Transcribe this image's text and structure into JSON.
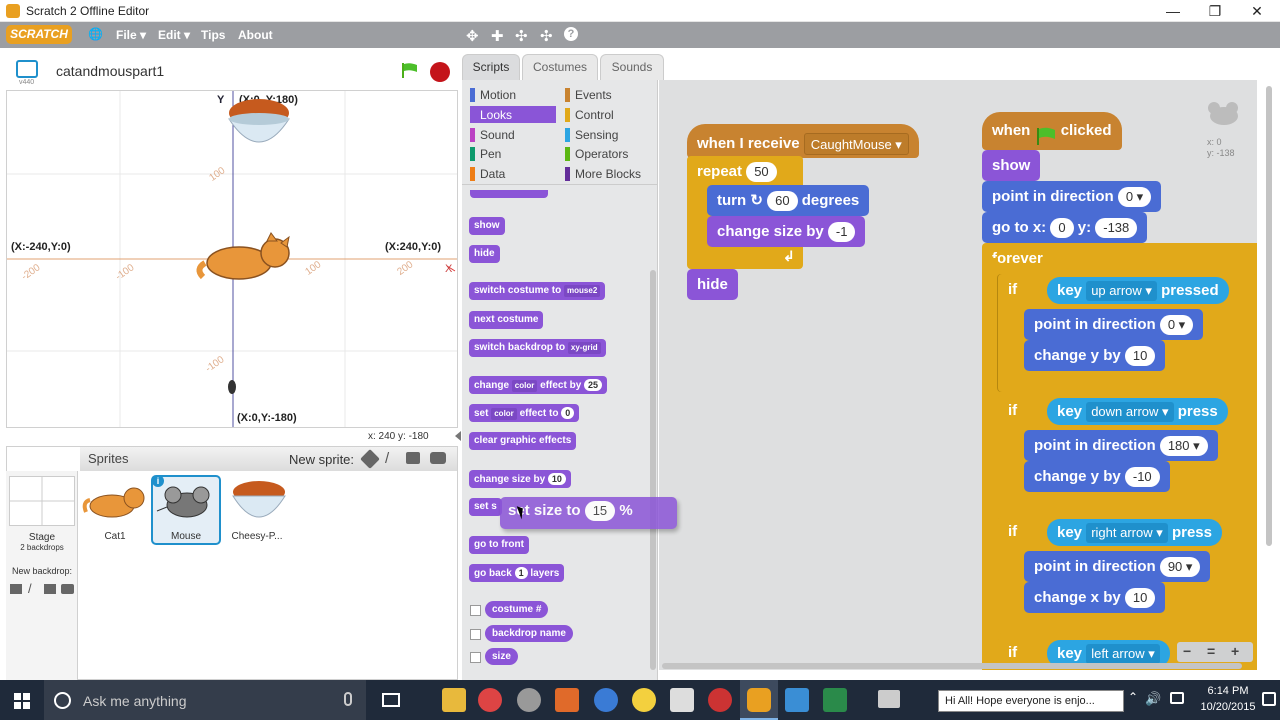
{
  "window": {
    "title": "Scratch 2 Offline Editor",
    "minimize": "—",
    "restore": "❐",
    "close": "✕"
  },
  "menubar": {
    "logo": "SCRATCH",
    "globe": "🌐",
    "file": "File ▾",
    "edit": "Edit ▾",
    "tips": "Tips",
    "about": "About",
    "tools": [
      "✥",
      "✚",
      "✣",
      "✣",
      "?"
    ]
  },
  "stage": {
    "project_name": "catandmouspart1",
    "version": "v440",
    "axis_y_label": "Y",
    "axis_x_label": "X",
    "top_label": "(X:0, Y:180)",
    "left_label": "(X:-240,Y:0)",
    "right_label": "(X:240,Y:0)",
    "bottom_label": "(X:0,Y:-180)",
    "ticks": [
      "-200",
      "-100",
      "100",
      "200",
      "100",
      "-100"
    ],
    "mouse_readout": "x: 240   y: -180"
  },
  "sprites_panel": {
    "title": "Sprites",
    "new_sprite": "New sprite:",
    "stage_label": "Stage",
    "backdrops": "2 backdrops",
    "new_backdrop": "New backdrop:",
    "sprites": [
      {
        "name": "Cat1"
      },
      {
        "name": "Mouse"
      },
      {
        "name": "Cheesy-P..."
      }
    ],
    "info_badge": "i"
  },
  "tabs": [
    "Scripts",
    "Costumes",
    "Sounds"
  ],
  "categories": [
    {
      "name": "Motion",
      "color": "#4a6cd4"
    },
    {
      "name": "Events",
      "color": "#c88330"
    },
    {
      "name": "Looks",
      "color": "#8a55d7"
    },
    {
      "name": "Control",
      "color": "#e1a91a"
    },
    {
      "name": "Sound",
      "color": "#bb42c3"
    },
    {
      "name": "Sensing",
      "color": "#2ca5e2"
    },
    {
      "name": "Pen",
      "color": "#0e9a6c"
    },
    {
      "name": "Operators",
      "color": "#5cb712"
    },
    {
      "name": "Data",
      "color": "#ee7d16"
    },
    {
      "name": "More Blocks",
      "color": "#632d99"
    }
  ],
  "palette": {
    "show": "show",
    "hide": "hide",
    "switch_costume": "switch costume to",
    "switch_costume_val": "mouse2",
    "next_costume": "next costume",
    "switch_backdrop": "switch backdrop to",
    "switch_backdrop_val": "xy-grid",
    "change_effect": "change",
    "change_effect_dd": "color",
    "change_effect_mid": "effect by",
    "change_effect_val": "25",
    "set_effect": "set",
    "set_effect_dd": "color",
    "set_effect_mid": "effect to",
    "set_effect_val": "0",
    "clear_effects": "clear graphic effects",
    "change_size": "change size by",
    "change_size_val": "10",
    "set_partial": "set s",
    "go_front": "go to front",
    "go_back": "go back",
    "go_back_val": "1",
    "go_back_end": "layers",
    "rep_costume": "costume #",
    "rep_backdrop": "backdrop name",
    "rep_size": "size"
  },
  "dragging": {
    "pre": "set size to",
    "val": "15",
    "post": "%"
  },
  "scripts": {
    "when_receive": "when I receive",
    "message": "CaughtMouse",
    "repeat": "repeat",
    "repeat_val": "50",
    "turn": "turn",
    "turn_val": "60",
    "degrees": "degrees",
    "change_size": "change size by",
    "change_size_val": "-1",
    "hide": "hide",
    "when": "when",
    "clicked": "clicked",
    "show": "show",
    "point_dir": "point in direction",
    "point_dir_val": "0",
    "goto": "go to x:",
    "goto_x": "0",
    "goto_y_lbl": "y:",
    "goto_y": "-138",
    "forever": "forever",
    "if": "if",
    "key": "key",
    "up_arrow": "up arrow",
    "down_arrow": "down arrow",
    "right_arrow": "right arrow",
    "left_arrow": "left arrow",
    "pressed": "pressed",
    "press": "press",
    "pd0": "0",
    "change_y": "change y by",
    "change_y_val": "10",
    "pd180": "180",
    "change_y_val2": "-10",
    "pd90": "90",
    "change_x": "change x by",
    "change_x_val": "10",
    "readout_x": "x: 0",
    "readout_y": "y: -138",
    "zoom_out": "−",
    "zoom_reset": "=",
    "zoom_in": "+"
  },
  "taskbar": {
    "search": "Ask me anything",
    "notification": "Hi All! Hope everyone is enjo...",
    "time": "6:14 PM",
    "date": "10/20/2015"
  }
}
